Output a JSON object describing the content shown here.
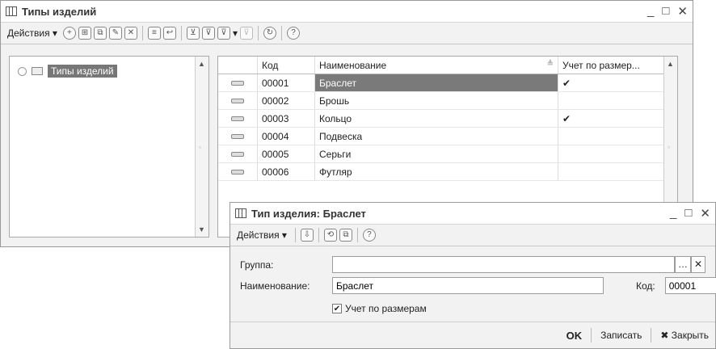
{
  "main": {
    "title": "Типы изделий",
    "actions_label": "Действия",
    "tree": {
      "root_label": "Типы изделий"
    },
    "grid": {
      "columns": [
        "Код",
        "Наименование",
        "Учет по размер..."
      ],
      "rows": [
        {
          "code": "00001",
          "name": "Браслет",
          "sized": "✔"
        },
        {
          "code": "00002",
          "name": "Брошь",
          "sized": ""
        },
        {
          "code": "00003",
          "name": "Кольцо",
          "sized": "✔"
        },
        {
          "code": "00004",
          "name": "Подвеска",
          "sized": ""
        },
        {
          "code": "00005",
          "name": "Серьги",
          "sized": ""
        },
        {
          "code": "00006",
          "name": "Футляр",
          "sized": ""
        }
      ]
    }
  },
  "dialog": {
    "title": "Тип изделия: Браслет",
    "actions_label": "Действия",
    "group_label": "Группа:",
    "group_value": "",
    "name_label": "Наименование:",
    "name_value": "Браслет",
    "code_label": "Код:",
    "code_value": "00001",
    "checkbox_label": "Учет по размерам",
    "ok_label": "OK",
    "save_label": "Записать",
    "close_label": "Закрыть"
  }
}
